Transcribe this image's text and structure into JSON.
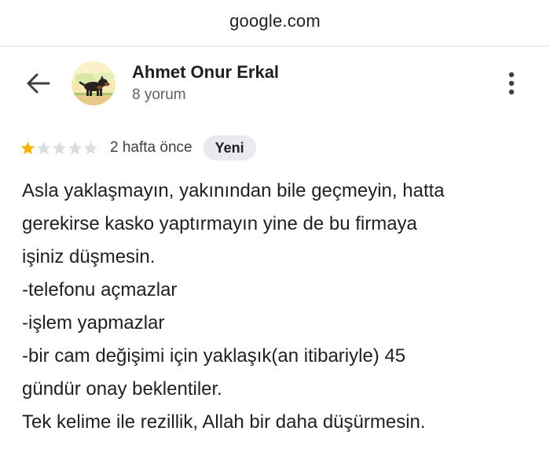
{
  "browser": {
    "url": "google.com"
  },
  "reviewer": {
    "name": "Ahmet Onur Erkal",
    "review_count": "8 yorum",
    "avatar_icon": "dog-avatar-icon"
  },
  "icons": {
    "back": "arrow-left-icon",
    "more": "vertical-dots-icon",
    "star": "star-icon"
  },
  "review": {
    "rating": 1,
    "max_rating": 5,
    "time": "2 hafta önce",
    "badge": "Yeni",
    "lines": [
      "Asla yaklaşmayın, yakınından bile geçmeyin, hatta",
      "gerekirse kasko yaptırmayın yine de bu firmaya",
      "işiniz düşmesin.",
      "-telefonu açmazlar",
      "-işlem yapmazlar",
      "-bir cam değişimi için yaklaşık(an itibariyle) 45",
      "gündür onay beklentiler.",
      "Tek kelime ile rezillik, Allah bir daha düşürmesin."
    ]
  },
  "colors": {
    "star_filled": "#f4b400",
    "star_empty": "#dadce0",
    "badge_bg": "#e8eaed",
    "text_primary": "#202124",
    "text_secondary": "#5f6368"
  }
}
